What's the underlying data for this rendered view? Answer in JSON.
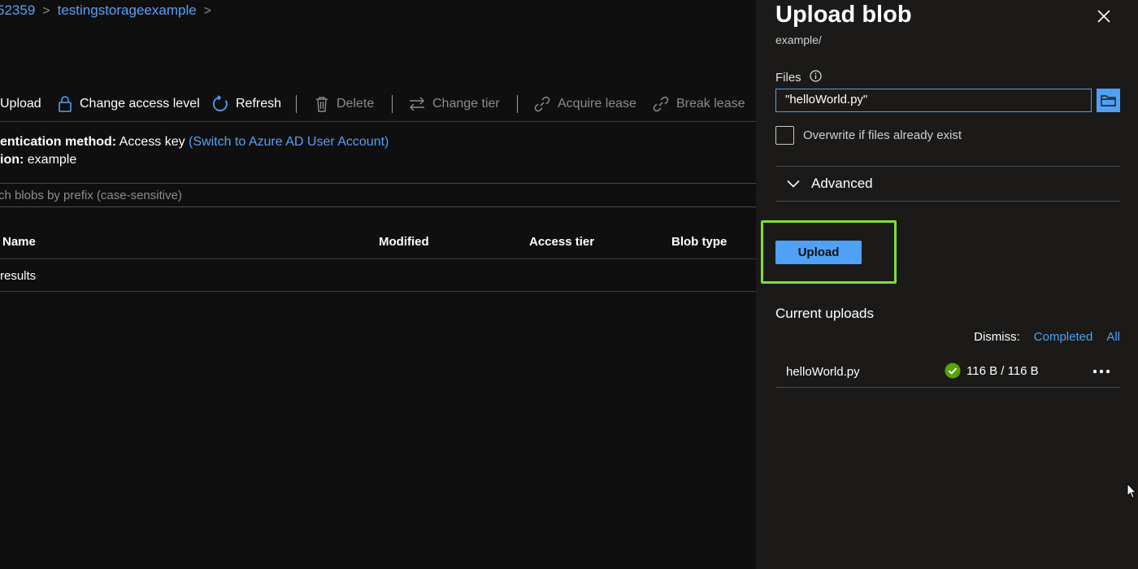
{
  "breadcrumb": {
    "items": [
      "52359",
      "testingstorageexample"
    ]
  },
  "toolbar": {
    "upload": "Upload",
    "change_access_level": "Change access level",
    "refresh": "Refresh",
    "delete": "Delete",
    "change_tier": "Change tier",
    "acquire_lease": "Acquire lease",
    "break_lease": "Break lease"
  },
  "info": {
    "auth_label": "entication method:",
    "auth_value": "Access key",
    "auth_link": "(Switch to Azure AD User Account)",
    "location_label": "ion:",
    "location_value": "example"
  },
  "search": {
    "placeholder": "ch blobs by prefix (case-sensitive)"
  },
  "table": {
    "columns": [
      "Name",
      "Modified",
      "Access tier",
      "Blob type"
    ],
    "empty_text": "results"
  },
  "panel": {
    "title": "Upload blob",
    "subtitle": "example/",
    "files_label": "Files",
    "files_value": "\"helloWorld.py\"",
    "overwrite_label": "Overwrite if files already exist",
    "advanced_label": "Advanced",
    "upload_button": "Upload",
    "current_uploads_title": "Current uploads",
    "dismiss_label": "Dismiss:",
    "dismiss_completed": "Completed",
    "dismiss_all": "All",
    "uploads": [
      {
        "name": "helloWorld.py",
        "progress": "116 B / 116 B",
        "status": "completed"
      }
    ]
  },
  "colors": {
    "accent": "#4ea1f7",
    "link": "#5aa0f5",
    "highlight": "#7ddf33",
    "success": "#57a300"
  }
}
